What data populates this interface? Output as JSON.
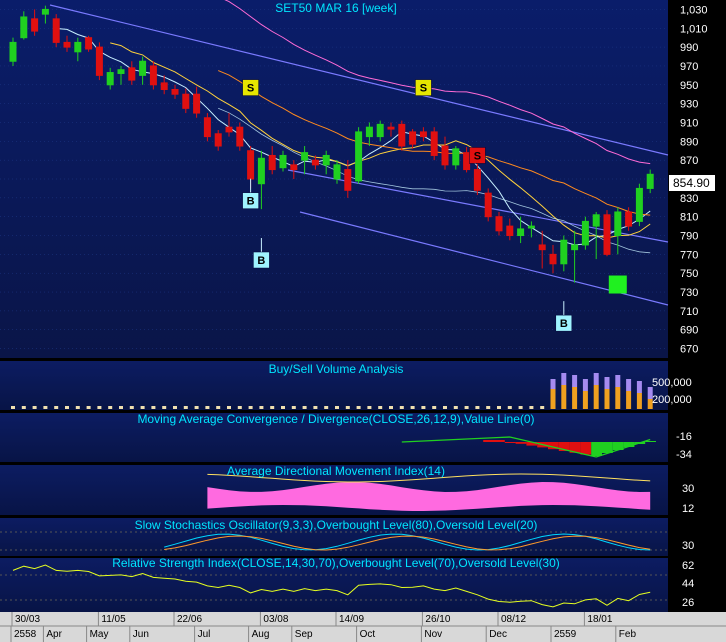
{
  "chart_data": {
    "type": "candlestick",
    "title": "SET50 MAR 16  [week]",
    "last_price_label": "854.90",
    "price_panel": {
      "ylim": [
        660,
        1040
      ],
      "yticks": [
        670,
        690,
        710,
        730,
        750,
        770,
        790,
        810,
        830,
        850,
        870,
        890,
        910,
        930,
        950,
        970,
        990,
        1010,
        1030
      ],
      "candles": [
        {
          "o": 975,
          "h": 1000,
          "l": 970,
          "c": 995
        },
        {
          "o": 1000,
          "h": 1028,
          "l": 998,
          "c": 1022
        },
        {
          "o": 1020,
          "h": 1030,
          "l": 1002,
          "c": 1007
        },
        {
          "o": 1025,
          "h": 1034,
          "l": 1015,
          "c": 1030
        },
        {
          "o": 1020,
          "h": 1025,
          "l": 990,
          "c": 995
        },
        {
          "o": 995,
          "h": 1002,
          "l": 985,
          "c": 990
        },
        {
          "o": 985,
          "h": 1000,
          "l": 975,
          "c": 995
        },
        {
          "o": 1000,
          "h": 1002,
          "l": 985,
          "c": 988
        },
        {
          "o": 990,
          "h": 995,
          "l": 955,
          "c": 960
        },
        {
          "o": 950,
          "h": 968,
          "l": 945,
          "c": 963
        },
        {
          "o": 962,
          "h": 970,
          "l": 950,
          "c": 966
        },
        {
          "o": 968,
          "h": 975,
          "l": 950,
          "c": 955
        },
        {
          "o": 960,
          "h": 980,
          "l": 950,
          "c": 975
        },
        {
          "o": 970,
          "h": 975,
          "l": 945,
          "c": 950
        },
        {
          "o": 952,
          "h": 960,
          "l": 940,
          "c": 945
        },
        {
          "o": 945,
          "h": 950,
          "l": 935,
          "c": 940
        },
        {
          "o": 940,
          "h": 946,
          "l": 920,
          "c": 925
        },
        {
          "o": 940,
          "h": 948,
          "l": 915,
          "c": 920
        },
        {
          "o": 915,
          "h": 920,
          "l": 890,
          "c": 895
        },
        {
          "o": 898,
          "h": 902,
          "l": 880,
          "c": 885
        },
        {
          "o": 905,
          "h": 920,
          "l": 895,
          "c": 900
        },
        {
          "o": 905,
          "h": 910,
          "l": 880,
          "c": 885
        },
        {
          "o": 880,
          "h": 885,
          "l": 840,
          "c": 850
        },
        {
          "o": 845,
          "h": 880,
          "l": 818,
          "c": 872
        },
        {
          "o": 875,
          "h": 885,
          "l": 855,
          "c": 860
        },
        {
          "o": 862,
          "h": 880,
          "l": 858,
          "c": 875
        },
        {
          "o": 865,
          "h": 870,
          "l": 850,
          "c": 860
        },
        {
          "o": 870,
          "h": 885,
          "l": 855,
          "c": 878
        },
        {
          "o": 870,
          "h": 875,
          "l": 860,
          "c": 865
        },
        {
          "o": 865,
          "h": 880,
          "l": 855,
          "c": 875
        },
        {
          "o": 850,
          "h": 870,
          "l": 845,
          "c": 865
        },
        {
          "o": 860,
          "h": 870,
          "l": 830,
          "c": 838
        },
        {
          "o": 848,
          "h": 905,
          "l": 845,
          "c": 900
        },
        {
          "o": 895,
          "h": 910,
          "l": 885,
          "c": 905
        },
        {
          "o": 895,
          "h": 912,
          "l": 890,
          "c": 908
        },
        {
          "o": 905,
          "h": 910,
          "l": 895,
          "c": 903
        },
        {
          "o": 908,
          "h": 912,
          "l": 880,
          "c": 885
        },
        {
          "o": 900,
          "h": 903,
          "l": 882,
          "c": 887
        },
        {
          "o": 900,
          "h": 905,
          "l": 890,
          "c": 895
        },
        {
          "o": 900,
          "h": 905,
          "l": 870,
          "c": 875
        },
        {
          "o": 885,
          "h": 895,
          "l": 860,
          "c": 865
        },
        {
          "o": 865,
          "h": 885,
          "l": 860,
          "c": 882
        },
        {
          "o": 878,
          "h": 884,
          "l": 857,
          "c": 860
        },
        {
          "o": 860,
          "h": 866,
          "l": 833,
          "c": 838
        },
        {
          "o": 835,
          "h": 840,
          "l": 805,
          "c": 810
        },
        {
          "o": 810,
          "h": 815,
          "l": 790,
          "c": 795
        },
        {
          "o": 800,
          "h": 808,
          "l": 785,
          "c": 790
        },
        {
          "o": 790,
          "h": 810,
          "l": 782,
          "c": 797
        },
        {
          "o": 798,
          "h": 805,
          "l": 788,
          "c": 800
        },
        {
          "o": 780,
          "h": 795,
          "l": 755,
          "c": 775
        },
        {
          "o": 770,
          "h": 780,
          "l": 750,
          "c": 760
        },
        {
          "o": 760,
          "h": 790,
          "l": 752,
          "c": 785
        },
        {
          "o": 775,
          "h": 795,
          "l": 740,
          "c": 780
        },
        {
          "o": 780,
          "h": 810,
          "l": 775,
          "c": 805
        },
        {
          "o": 800,
          "h": 815,
          "l": 765,
          "c": 812
        },
        {
          "o": 812,
          "h": 817,
          "l": 768,
          "c": 770
        },
        {
          "o": 790,
          "h": 820,
          "l": 770,
          "c": 815
        },
        {
          "o": 815,
          "h": 820,
          "l": 795,
          "c": 800
        },
        {
          "o": 805,
          "h": 845,
          "l": 800,
          "c": 840
        },
        {
          "o": 840,
          "h": 860,
          "l": 835,
          "c": 855
        }
      ],
      "signals": [
        {
          "type": "S",
          "color": "#e6e600",
          "index": 22,
          "price": 947
        },
        {
          "type": "S",
          "color": "#e6e600",
          "index": 38,
          "price": 947
        },
        {
          "type": "S",
          "color": "#e01010",
          "index": 43,
          "price": 875
        },
        {
          "type": "B",
          "color": "#9ff4ff",
          "index": 22,
          "price": 827
        },
        {
          "type": "B",
          "color": "#9ff4ff",
          "index": 23,
          "price": 764
        },
        {
          "type": "B",
          "color": "#9ff4ff",
          "index": 51,
          "price": 697
        }
      ]
    },
    "volume_panel": {
      "title": "Buy/Sell Volume Analysis",
      "yticks": [
        "500,000",
        "200,000"
      ]
    },
    "macd_panel": {
      "title": "Moving Average Convergence / Divergence(CLOSE,26,12,9),Value Line(0)",
      "yticks": [
        "-16",
        "-34"
      ]
    },
    "adx_panel": {
      "title": "Average Directional Movement Index(14)",
      "yticks": [
        "30",
        "12"
      ]
    },
    "stoch_panel": {
      "title": "Slow Stochastics Oscillator(9,3,3),Overbought Level(80),Oversold Level(20)",
      "yticks": [
        "30"
      ]
    },
    "rsi_panel": {
      "title": "Relative Strength Index(CLOSE,14,30,70),Overbought Level(70),Oversold Level(30)",
      "yticks": [
        "62",
        "44",
        "26"
      ]
    },
    "x_axis": {
      "top": [
        "30/03",
        "11/05",
        "22/06",
        "03/08",
        "14/09",
        "26/10",
        "08/12",
        "18/01"
      ],
      "bottom": [
        "2558",
        "Apr",
        "May",
        "Jun",
        "Jul",
        "Aug",
        "Sep",
        "Oct",
        "Nov",
        "Dec",
        "2559",
        "Feb"
      ]
    },
    "colors": {
      "up": "#20d020",
      "down": "#e01010",
      "channel": "#7a7aff",
      "ma_fast": "#c8f0ff",
      "ma_mid": "#ffd23c",
      "ma_slow": "#ff8a1e",
      "upper_band": "#ff6bd6",
      "adx_fill": "#ff6ae0",
      "text": "#00e6ff"
    }
  }
}
